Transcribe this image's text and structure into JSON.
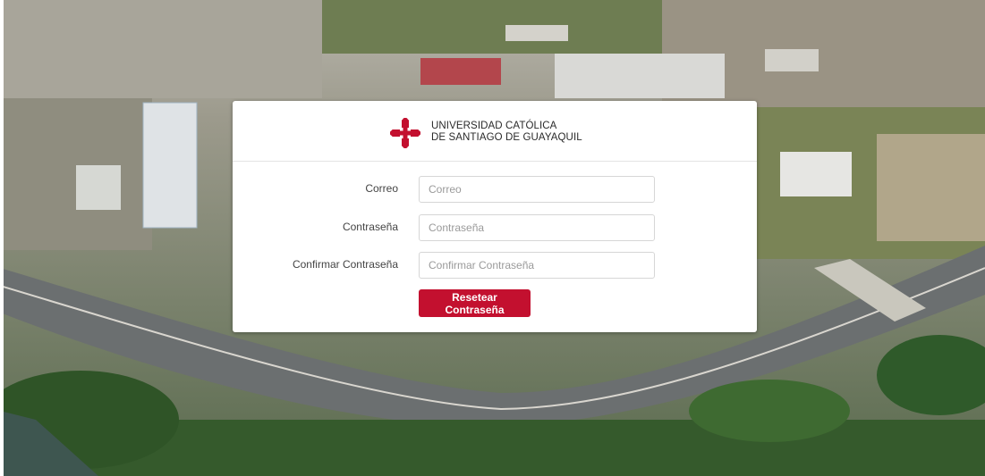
{
  "header": {
    "brand_line1": "UNIVERSIDAD CATÓLICA",
    "brand_line2": "DE SANTIAGO DE GUAYAQUIL",
    "logo_icon": "ucsg-cross-icon",
    "brand_color": "#c3102f"
  },
  "form": {
    "email": {
      "label": "Correo",
      "placeholder": "Correo",
      "value": ""
    },
    "password": {
      "label": "Contraseña",
      "placeholder": "Contraseña",
      "value": ""
    },
    "confirm_password": {
      "label": "Confirmar Contraseña",
      "placeholder": "Confirmar Contraseña",
      "value": ""
    },
    "submit_label": "Resetear Contraseña"
  },
  "background": {
    "icon": "aerial-campus-photo"
  }
}
